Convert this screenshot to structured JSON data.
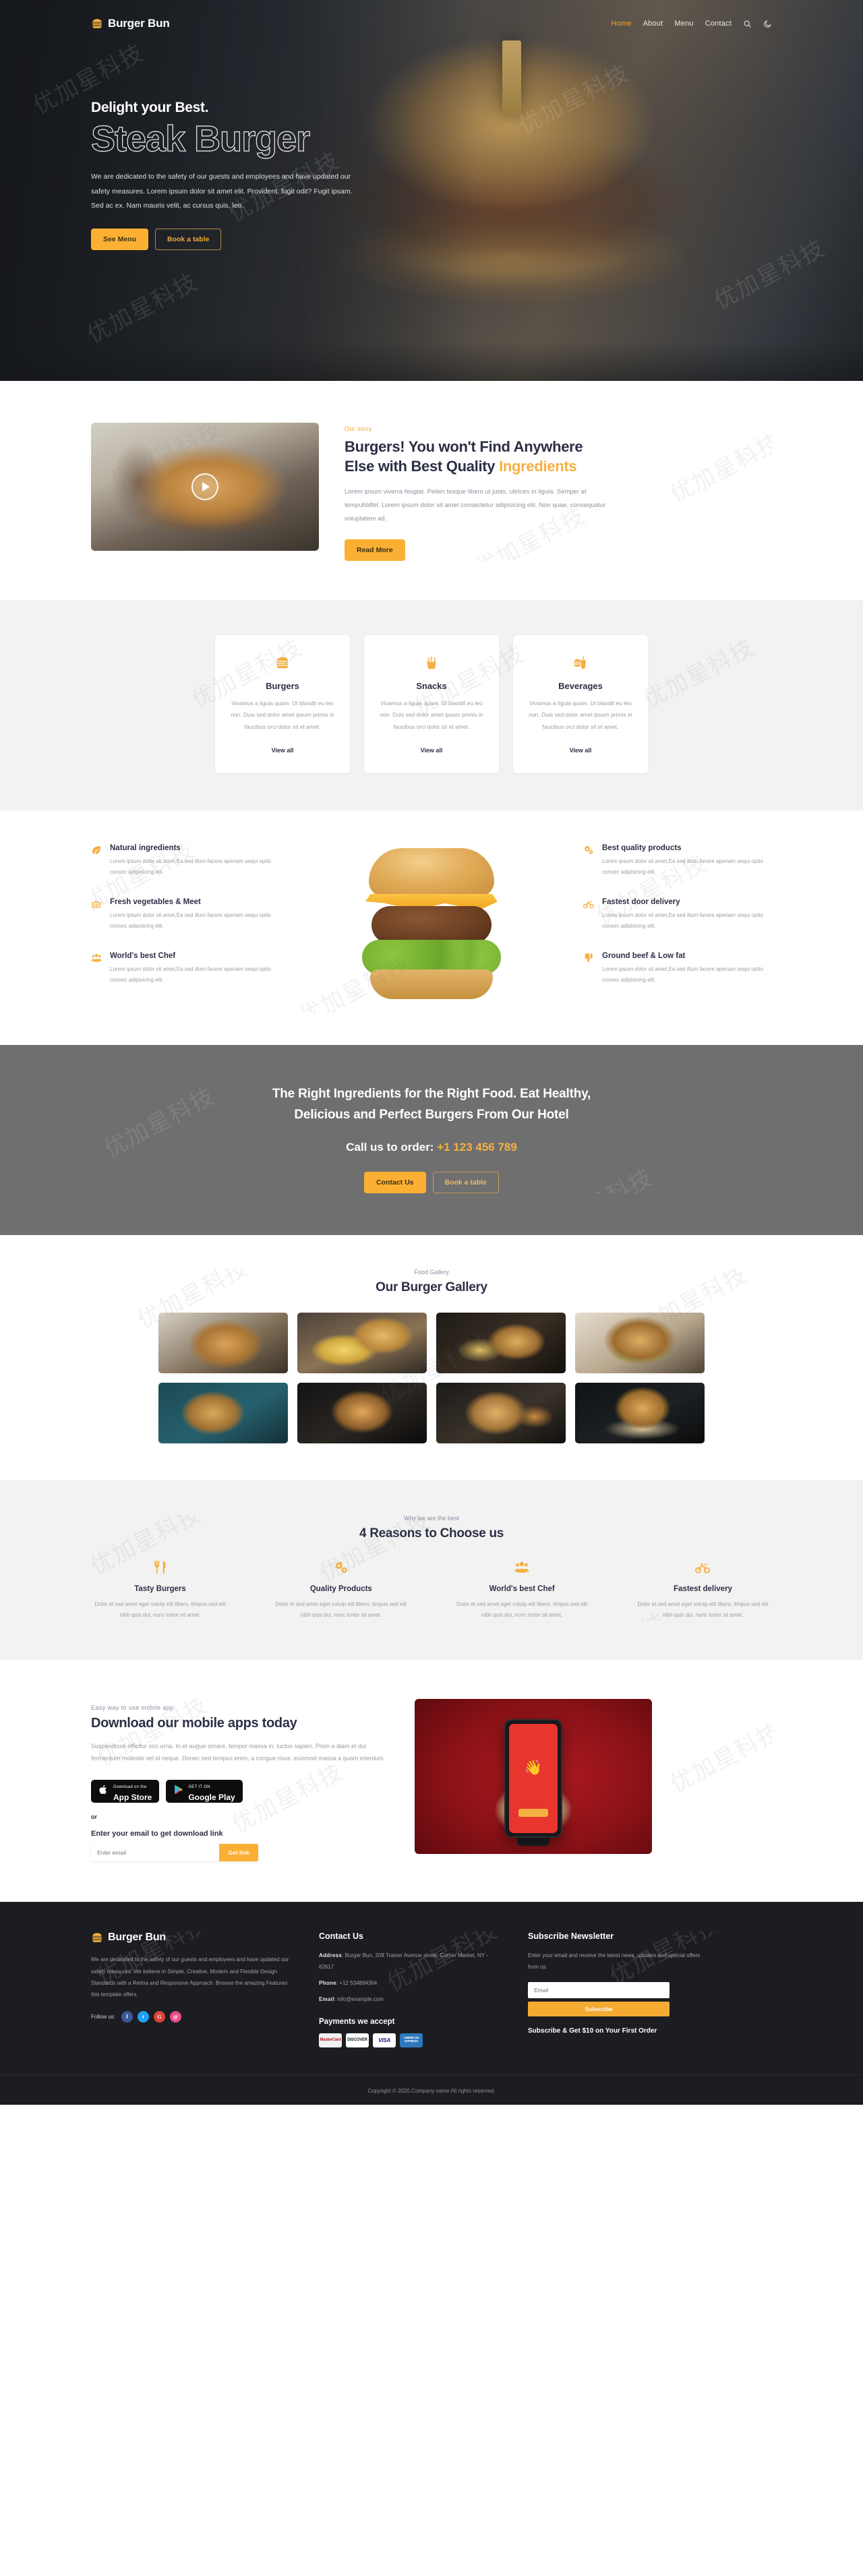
{
  "brand": {
    "name": "Burger Bun",
    "icon": "burger-icon"
  },
  "nav": {
    "links": [
      {
        "label": "Home",
        "active": true
      },
      {
        "label": "About",
        "active": false
      },
      {
        "label": "Menu",
        "active": false
      },
      {
        "label": "Contact",
        "active": false
      }
    ],
    "search_icon": "search-icon",
    "theme_icon": "moon-icon"
  },
  "hero": {
    "kicker": "Delight your Best.",
    "title": "Steak Burger",
    "description": "We are dedicated to the safety of our guests and employees and have updated our safety measures. Lorem ipsum dolor sit amet elit. Provident. fugit odit? Fugit ipsam. Sed ac ex. Nam mauris velit, ac cursus quis, leo.",
    "primary_button": "See Menu",
    "secondary_button": "Book a table"
  },
  "story": {
    "eyebrow": "Our story",
    "heading_plain": "Burgers! You won't Find Anywhere Else with Best Quality ",
    "heading_accent": "Ingredients",
    "paragraph": "Lorem ipsum viverra feugiat. Pellen tesque libero ut justo, ultrices in ligula. Semper at tempufddfel. Lorem ipsum dolor sit amet consectetur adipisicing elit. Non quae, consequatur voluptatem ad.",
    "button": "Read More",
    "play_icon": "play-icon"
  },
  "categories": [
    {
      "icon": "burger-icon",
      "title": "Burgers",
      "text": "Vivamus a ligula quam. Ut blandit eu leo non. Duis sed dolor amet ipsum primis in faucibus orci dolor sit et amet.",
      "link": "View all"
    },
    {
      "icon": "fries-icon",
      "title": "Snacks",
      "text": "Vivamus a ligula quam. Ut blandit eu leo non. Duis sed dolor amet ipsum primis in faucibus orci dolor sit et amet.",
      "link": "View all"
    },
    {
      "icon": "drink-icon",
      "title": "Beverages",
      "text": "Vivamus a ligula quam. Ut blandit eu leo non. Duis sed dolor amet ipsum primis in faucibus orci dolor sit et amet.",
      "link": "View all"
    }
  ],
  "features": {
    "shared_text": "Lorem ipsum dolor sit amet,Ea sed illum facere aperiam sequi optio consec adipisicing elit.",
    "left": [
      {
        "icon": "leaf-icon",
        "title": "Natural ingredients"
      },
      {
        "icon": "basket-icon",
        "title": "Fresh vegetables & Meet"
      },
      {
        "icon": "chef-group-icon",
        "title": "World's best Chef"
      }
    ],
    "right": [
      {
        "icon": "gears-icon",
        "title": "Best quality products"
      },
      {
        "icon": "motorbike-icon",
        "title": "Fastest door delivery"
      },
      {
        "icon": "thumbs-down-icon",
        "title": "Ground beef & Low fat"
      }
    ]
  },
  "cta": {
    "line1": "The Right Ingredients for the Right Food. Eat Healthy,",
    "line2": "Delicious and Perfect Burgers From Our Hotel",
    "call_label": "Call us to order: ",
    "phone": "+1 123 456 789",
    "primary_button": "Contact Us",
    "secondary_button": "Book a table"
  },
  "gallery": {
    "eyebrow": "Food Gallery",
    "heading": "Our Burger Gallery",
    "items": [
      {
        "alt": "burger-with-fries-on-wooden-board"
      },
      {
        "alt": "burger-and-fries-on-round-board"
      },
      {
        "alt": "burger-with-fries-dark-background"
      },
      {
        "alt": "double-cheeseburger-on-wood"
      },
      {
        "alt": "burger-on-teal-background"
      },
      {
        "alt": "burger-with-greens-on-plate"
      },
      {
        "alt": "burger-with-wedges-and-ketchup"
      },
      {
        "alt": "stacked-bacon-cheeseburger"
      }
    ]
  },
  "reasons": {
    "eyebrow": "Why we are the best",
    "heading": "4 Reasons to Choose us",
    "shared_text": "Dolor et sed amet eget volutp elit libero. timpus sed elit nibh quis dui, nunc tortor sit amet.",
    "items": [
      {
        "icon": "cutlery-icon",
        "title": "Tasty Burgers"
      },
      {
        "icon": "gears-icon",
        "title": "Quality Products"
      },
      {
        "icon": "chef-group-icon",
        "title": "World's best Chef"
      },
      {
        "icon": "motorbike-icon",
        "title": "Fastest delivery"
      }
    ]
  },
  "apps": {
    "eyebrow": "Easy way to use mobile app",
    "heading": "Download our mobile apps today",
    "paragraph": "Suspendisse efficitur orci urna. In et augue ornare, tempor massa in, luctus sapien. Proin a diam et dui fermentum molestie vel id neque. Donec sed tempus enim, a congue risus. euismod massa a quam interdum.",
    "appstore": {
      "small": "Download on the",
      "big": "App Store",
      "icon": "apple-icon"
    },
    "googleplay": {
      "small": "GET IT ON",
      "big": "Google Play",
      "icon": "play-store-icon"
    },
    "or": "or",
    "get_label": "Enter your email to get download link",
    "input_placeholder": "Enter email",
    "get_button": "Get link"
  },
  "footer": {
    "brand": "Burger Bun",
    "about": "We are dedicated to the safety of our guests and employees and have updated our safety measures. We believe in Simple, Creative, Modern and Flexible Design Standards with a Retina and Responsive Approach. Browse the amazing Features this template offers.",
    "follow_label": "Follow us:",
    "socials": [
      {
        "name": "facebook-icon",
        "glyph": "f",
        "color": "#3b5998"
      },
      {
        "name": "twitter-icon",
        "glyph": "t",
        "color": "#1da1f2"
      },
      {
        "name": "google-plus-icon",
        "glyph": "G",
        "color": "#db4437"
      },
      {
        "name": "dribbble-icon",
        "glyph": "@",
        "color": "#ea4c89"
      }
    ],
    "contact": {
      "heading": "Contact Us",
      "address_label": "Address",
      "address_value": ": Burger Bun, 208 Trainer Avenue street, Corner Market, NY - 62617",
      "phone_label": "Phone",
      "phone_value": ": +12 534894364",
      "email_label": "Email",
      "email_value": ": info@example.com",
      "payments_heading": "Payments we accept",
      "payments": [
        {
          "name": "mastercard-card",
          "label": "MasterCard",
          "bg": "#f0f0f0",
          "fg": "#222"
        },
        {
          "name": "discover-card",
          "label": "DISCOVER",
          "bg": "#ffffff",
          "fg": "#222"
        },
        {
          "name": "visa-card",
          "label": "VISA",
          "bg": "#ffffff",
          "fg": "#1a1f71"
        },
        {
          "name": "amex-card",
          "label": "AMERICAN EXPRESS",
          "bg": "#2e77bc",
          "fg": "#ffffff"
        }
      ]
    },
    "newsletter": {
      "heading": "Subscribe Newsletter",
      "text": "Enter your email and receive the latest news, updates and special offers from us.",
      "input_placeholder": "Email",
      "button": "Subscribe",
      "promo": "Subscribe & Get $10 on Your First Order"
    },
    "copyright": "Copyright © 2020.Company name All rights reserved."
  },
  "colors": {
    "accent": "#f5b041",
    "accent_solid": "#fbb034",
    "dark": "#1c1d21",
    "heading": "#2c2f45",
    "muted": "#9a9da8",
    "band": "#6f6f6f"
  },
  "watermark_text": "优加星科技"
}
